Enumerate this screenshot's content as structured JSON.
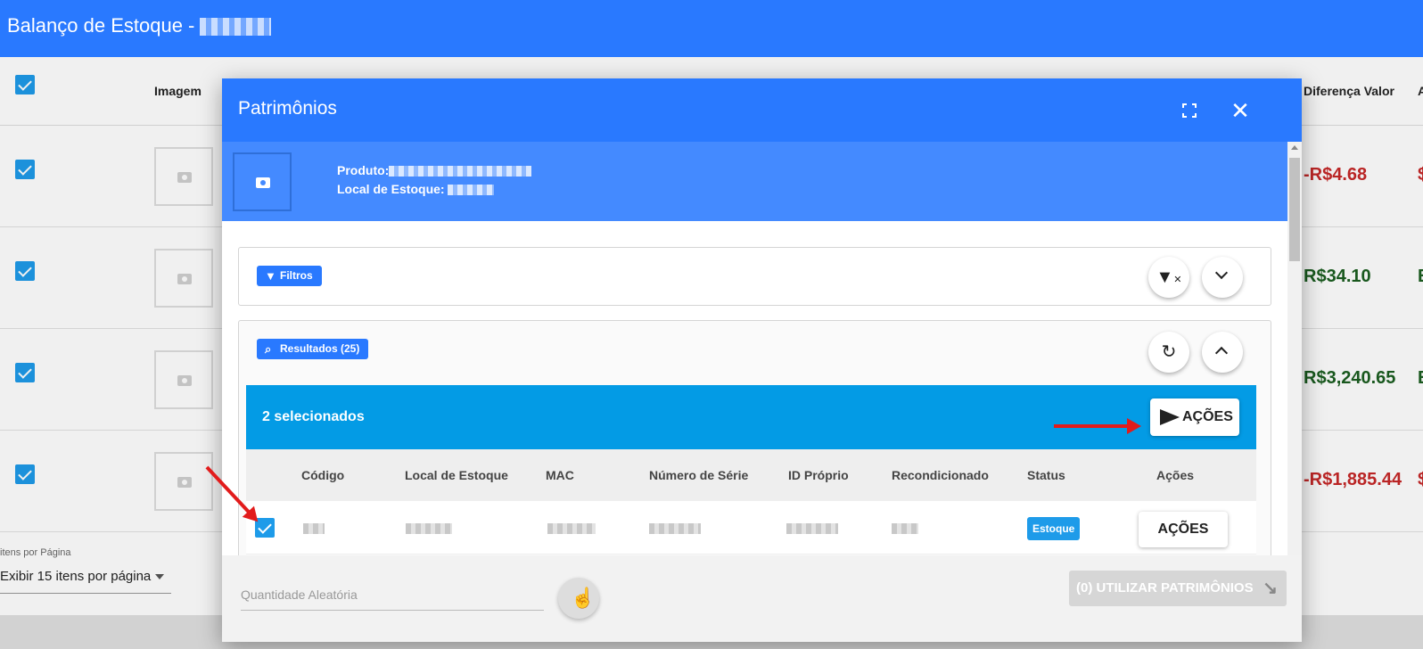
{
  "app": {
    "title": "Balanço de Estoque -"
  },
  "table": {
    "headers": {
      "image": "Imagem",
      "diff_value": "Diferença Valor"
    },
    "rows": [
      {
        "diff_value": "-R$4.68",
        "next_char": "$"
      },
      {
        "diff_value": "R$34.10",
        "next_char": "E"
      },
      {
        "diff_value": "R$3,240.65",
        "next_char": "E"
      },
      {
        "diff_value": "-R$1,885.44",
        "next_char": "$"
      }
    ]
  },
  "pagination": {
    "label": "itens por Página",
    "value": "Exibir 15 itens por página"
  },
  "modal": {
    "title": "Patrimônios",
    "product_label": "Produto:",
    "stock_location_label": "Local de Estoque:",
    "filters_label": "Filtros",
    "results_label": "Resultados (25)",
    "selected_text": "2 selecionados",
    "actions_button": "AÇÕES",
    "columns": [
      "Código",
      "Local de Estoque",
      "MAC",
      "Número de Série",
      "ID Próprio",
      "Recondicionado",
      "Status",
      "Ações"
    ],
    "row": {
      "status": "Estoque",
      "actions": "AÇÕES"
    },
    "random_qty_placeholder": "Quantidade Aleatória",
    "use_button": "(0) UTILIZAR PATRIMÔNIOS"
  },
  "colors": {
    "primary": "#2979ff",
    "selection_bar": "#039be5",
    "negative": "#c62828",
    "positive": "#1b5e20",
    "annotation": "#e21b1b"
  },
  "icons": [
    "camera-icon",
    "fullscreen-icon",
    "close-icon",
    "filter-icon",
    "clear-filter-icon",
    "chevron-down-icon",
    "search-icon",
    "refresh-icon",
    "chevron-up-icon",
    "send-icon",
    "hand-pointer-icon",
    "arrow-down-right-icon"
  ]
}
